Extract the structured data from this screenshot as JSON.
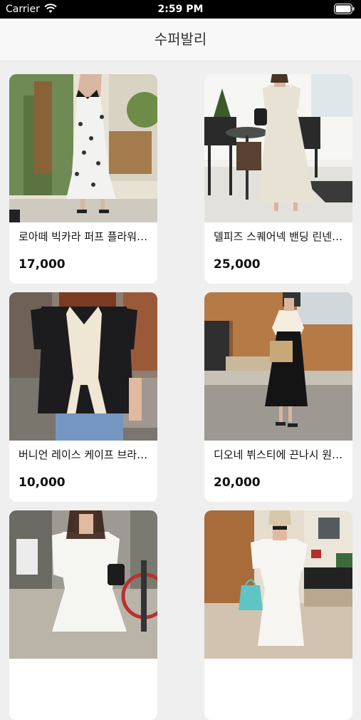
{
  "status_bar": {
    "carrier": "Carrier",
    "time": "2:59 PM",
    "icons": [
      "wifi-icon",
      "battery-icon"
    ]
  },
  "nav": {
    "title": "수퍼발리"
  },
  "products": [
    {
      "name": "로아떼 빅카라 퍼프 플라워 원피스",
      "price": "17,000"
    },
    {
      "name": "델피즈 스퀘어넥 밴딩 린넨 원피스",
      "price": "25,000"
    },
    {
      "name": "버니언 레이스 케이프 브라우스",
      "price": "10,000"
    },
    {
      "name": "디오네 뷔스티에 끈나시 원피스",
      "price": "20,000"
    },
    {
      "name": "",
      "price": ""
    },
    {
      "name": "",
      "price": ""
    }
  ],
  "colors": {
    "background": "#efefef",
    "card": "#ffffff",
    "text": "#111111"
  }
}
